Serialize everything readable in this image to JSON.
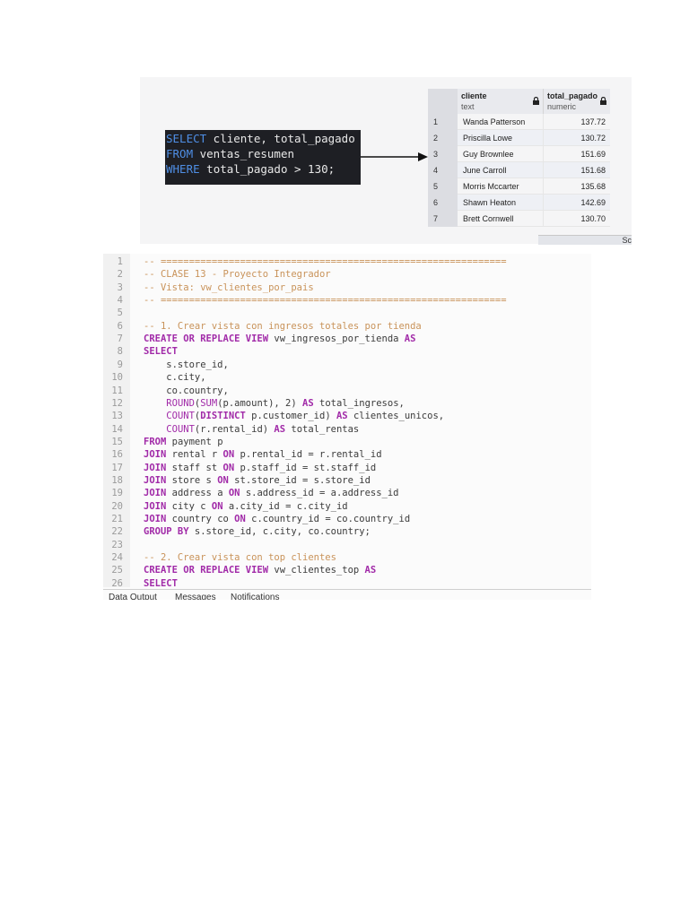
{
  "query": {
    "lines": [
      {
        "kw": "SELECT",
        "rest": " cliente, total_pagado"
      },
      {
        "kw": "FROM",
        "rest": " ventas_resumen"
      },
      {
        "kw": "WHERE",
        "rest": " total_pagado > 130;"
      }
    ]
  },
  "grid": {
    "columns": [
      {
        "name": "cliente",
        "type": "text"
      },
      {
        "name": "total_pagado",
        "type": "numeric"
      }
    ],
    "rows": [
      {
        "n": "1",
        "cliente": "Wanda Patterson",
        "total": "137.72"
      },
      {
        "n": "2",
        "cliente": "Priscilla Lowe",
        "total": "130.72"
      },
      {
        "n": "3",
        "cliente": "Guy Brownlee",
        "total": "151.69"
      },
      {
        "n": "4",
        "cliente": "June Carroll",
        "total": "151.68"
      },
      {
        "n": "5",
        "cliente": "Morris Mccarter",
        "total": "135.68"
      },
      {
        "n": "6",
        "cliente": "Shawn Heaton",
        "total": "142.69"
      },
      {
        "n": "7",
        "cliente": "Brett Cornwell",
        "total": "130.70"
      }
    ],
    "footer_fragment": "Sc"
  },
  "editor": {
    "lines": [
      {
        "n": "1",
        "tokens": [
          [
            "cm",
            "-- ============================================================="
          ]
        ]
      },
      {
        "n": "2",
        "tokens": [
          [
            "cm",
            "-- CLASE 13 - Proyecto Integrador"
          ]
        ]
      },
      {
        "n": "3",
        "tokens": [
          [
            "cm",
            "-- Vista: vw_clientes_por_pais"
          ]
        ]
      },
      {
        "n": "4",
        "tokens": [
          [
            "cm",
            "-- ============================================================="
          ]
        ]
      },
      {
        "n": "5",
        "tokens": []
      },
      {
        "n": "6",
        "tokens": [
          [
            "cm",
            "-- 1. Crear vista con ingresos totales por tienda"
          ]
        ]
      },
      {
        "n": "7",
        "tokens": [
          [
            "k",
            "CREATE OR REPLACE VIEW"
          ],
          [
            "id",
            " vw_ingresos_por_tienda "
          ],
          [
            "k",
            "AS"
          ]
        ]
      },
      {
        "n": "8",
        "tokens": [
          [
            "k",
            "SELECT"
          ]
        ]
      },
      {
        "n": "9",
        "tokens": [
          [
            "id",
            "    s.store_id,"
          ]
        ]
      },
      {
        "n": "10",
        "tokens": [
          [
            "id",
            "    c.city,"
          ]
        ]
      },
      {
        "n": "11",
        "tokens": [
          [
            "id",
            "    co.country,"
          ]
        ]
      },
      {
        "n": "12",
        "tokens": [
          [
            "id",
            "    "
          ],
          [
            "fn",
            "ROUND"
          ],
          [
            "id",
            "("
          ],
          [
            "fn",
            "SUM"
          ],
          [
            "id",
            "(p.amount), 2) "
          ],
          [
            "k",
            "AS"
          ],
          [
            "id",
            " total_ingresos,"
          ]
        ]
      },
      {
        "n": "13",
        "tokens": [
          [
            "id",
            "    "
          ],
          [
            "fn",
            "COUNT"
          ],
          [
            "id",
            "("
          ],
          [
            "k",
            "DISTINCT"
          ],
          [
            "id",
            " p.customer_id) "
          ],
          [
            "k",
            "AS"
          ],
          [
            "id",
            " clientes_unicos,"
          ]
        ]
      },
      {
        "n": "14",
        "tokens": [
          [
            "id",
            "    "
          ],
          [
            "fn",
            "COUNT"
          ],
          [
            "id",
            "(r.rental_id) "
          ],
          [
            "k",
            "AS"
          ],
          [
            "id",
            " total_rentas"
          ]
        ]
      },
      {
        "n": "15",
        "tokens": [
          [
            "k",
            "FROM"
          ],
          [
            "id",
            " payment p"
          ]
        ]
      },
      {
        "n": "16",
        "tokens": [
          [
            "k",
            "JOIN"
          ],
          [
            "id",
            " rental r "
          ],
          [
            "k",
            "ON"
          ],
          [
            "id",
            " p.rental_id = r.rental_id"
          ]
        ]
      },
      {
        "n": "17",
        "tokens": [
          [
            "k",
            "JOIN"
          ],
          [
            "id",
            " staff st "
          ],
          [
            "k",
            "ON"
          ],
          [
            "id",
            " p.staff_id = st.staff_id"
          ]
        ]
      },
      {
        "n": "18",
        "tokens": [
          [
            "k",
            "JOIN"
          ],
          [
            "id",
            " store s "
          ],
          [
            "k",
            "ON"
          ],
          [
            "id",
            " st.store_id = s.store_id"
          ]
        ]
      },
      {
        "n": "19",
        "tokens": [
          [
            "k",
            "JOIN"
          ],
          [
            "id",
            " address a "
          ],
          [
            "k",
            "ON"
          ],
          [
            "id",
            " s.address_id = a.address_id"
          ]
        ]
      },
      {
        "n": "20",
        "tokens": [
          [
            "k",
            "JOIN"
          ],
          [
            "id",
            " city c "
          ],
          [
            "k",
            "ON"
          ],
          [
            "id",
            " a.city_id = c.city_id"
          ]
        ]
      },
      {
        "n": "21",
        "tokens": [
          [
            "k",
            "JOIN"
          ],
          [
            "id",
            " country co "
          ],
          [
            "k",
            "ON"
          ],
          [
            "id",
            " c.country_id = co.country_id"
          ]
        ]
      },
      {
        "n": "22",
        "tokens": [
          [
            "k",
            "GROUP BY"
          ],
          [
            "id",
            " s.store_id, c.city, co.country;"
          ]
        ]
      },
      {
        "n": "23",
        "tokens": []
      },
      {
        "n": "24",
        "tokens": [
          [
            "cm",
            "-- 2. Crear vista con top clientes"
          ]
        ]
      },
      {
        "n": "25",
        "tokens": [
          [
            "k",
            "CREATE OR REPLACE VIEW"
          ],
          [
            "id",
            " vw_clientes_top "
          ],
          [
            "k",
            "AS"
          ]
        ]
      },
      {
        "n": "26",
        "tokens": [
          [
            "k",
            "SELECT"
          ]
        ]
      }
    ],
    "bottom_tabs": [
      "Data Output",
      "Messages",
      "Notifications"
    ]
  },
  "colors": {
    "keyword": "#a12aa8",
    "comment": "#c9935a",
    "sql_keyword": "#4f8fe6"
  }
}
